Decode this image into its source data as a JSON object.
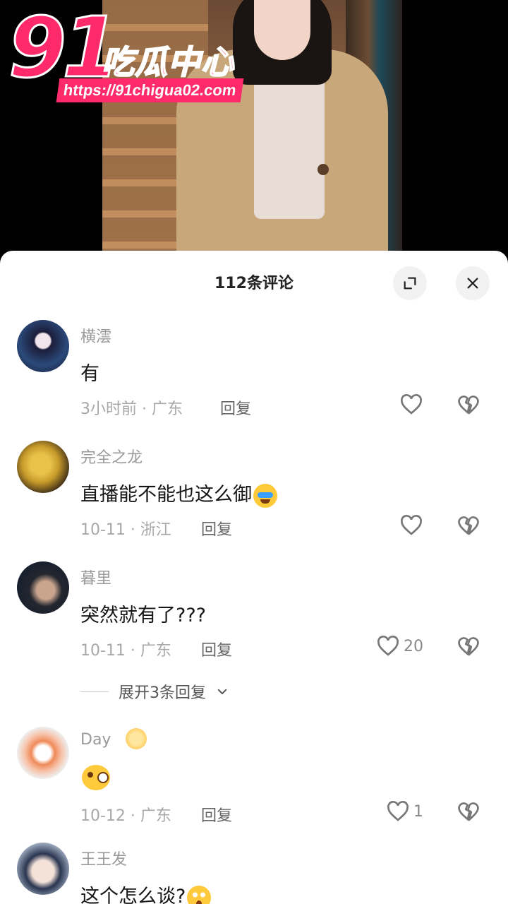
{
  "watermark": {
    "logo_number": "91",
    "logo_name": "吃瓜中心",
    "url": "https://91chigua02.com"
  },
  "panel": {
    "title": "112条评论"
  },
  "icons": {
    "expand": "expand-icon",
    "close": "close-icon",
    "like": "heart-icon",
    "dislike": "broken-heart-icon"
  },
  "comments": [
    {
      "user": "横澐",
      "text": "有",
      "meta": "3小时前 · 广东",
      "reply": "回复",
      "likes": ""
    },
    {
      "user": "完全之龙",
      "text": "直播能不能也这么御",
      "emoji": "loudly-crying-emoji",
      "meta": "10-11 · 浙江",
      "reply": "回复",
      "likes": ""
    },
    {
      "user": "暮里",
      "text": "突然就有了???",
      "meta": "10-11 · 广东",
      "reply": "回复",
      "likes": "20"
    },
    {
      "user": "Day",
      "text": "",
      "emoji": "sideeye-monocle-emoji",
      "meta": "10-12 · 广东",
      "reply": "回复",
      "likes": "1"
    },
    {
      "user": "王王发",
      "text": "这个怎么谈?",
      "emoji": "flushed-surprised-emoji",
      "meta": "",
      "reply": "",
      "likes": ""
    }
  ],
  "expand_replies": "展开3条回复"
}
